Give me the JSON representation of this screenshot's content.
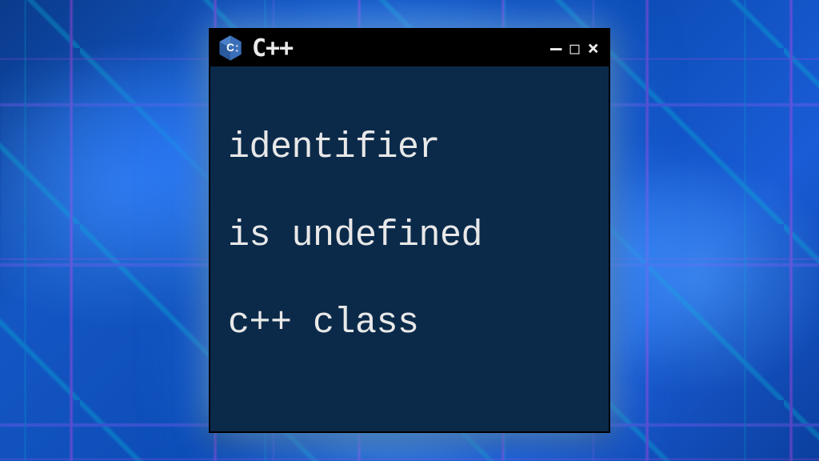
{
  "window": {
    "title": "C++",
    "icon_label": "cpp-icon",
    "controls": {
      "minimize": "–",
      "maximize": "□",
      "close": "×"
    }
  },
  "content": {
    "line1": "identifier",
    "line2": "is undefined",
    "line3": "c++ class"
  },
  "colors": {
    "window_bg": "#0b2a4a",
    "titlebar_bg": "#000000",
    "text": "#e8e8e8",
    "icon_hex_fill": "#2a5a9e",
    "icon_hex_dark": "#1a3f6f"
  }
}
